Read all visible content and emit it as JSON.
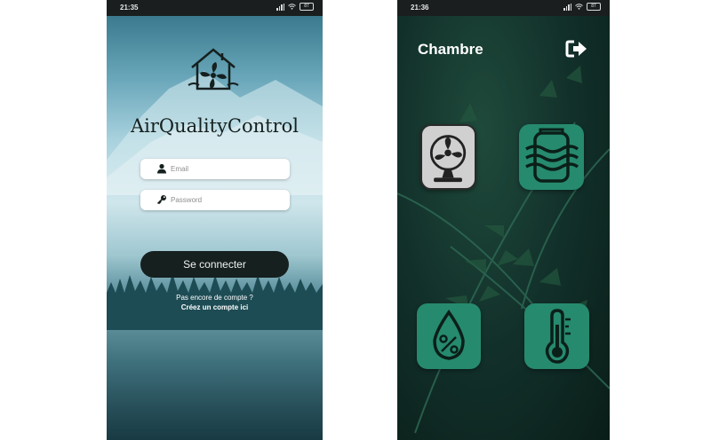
{
  "login_screen": {
    "status_bar": {
      "time": "21:35",
      "battery": "87"
    },
    "app_title": "AirQualityControl",
    "email": {
      "placeholder": "Email",
      "value": ""
    },
    "password": {
      "placeholder": "Password",
      "value": ""
    },
    "login_button": "Se connecter",
    "signup_prompt": "Pas encore de compte ?",
    "signup_link": "Créez un compte ici"
  },
  "room_screen": {
    "status_bar": {
      "time": "21:36",
      "battery": "87"
    },
    "room_title": "Chambre",
    "tiles": [
      {
        "name": "fan",
        "icon": "fan-icon"
      },
      {
        "name": "air-purifier",
        "icon": "air-purifier-icon"
      },
      {
        "name": "humidity",
        "icon": "humidity-percent-icon"
      },
      {
        "name": "temperature",
        "icon": "thermometer-icon"
      }
    ],
    "colors": {
      "tile": "#268a6e",
      "fan_tile": "#d0d0d0",
      "background": "#0f2a23"
    }
  }
}
